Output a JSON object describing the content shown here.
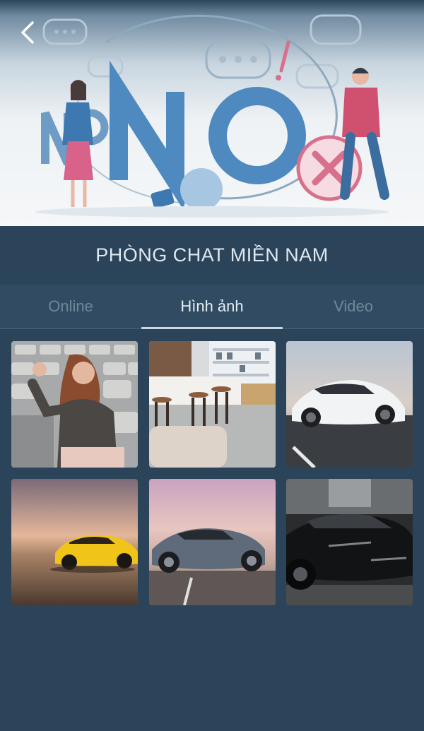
{
  "header": {
    "title": "PHÒNG CHAT MIỀN NAM",
    "back_icon": "chevron-left-icon",
    "banner_text": "NO NO"
  },
  "tabs": [
    {
      "label": "Online",
      "active": false
    },
    {
      "label": "Hình ảnh",
      "active": true
    },
    {
      "label": "Video",
      "active": false
    }
  ],
  "gallery": {
    "items": [
      {
        "subject": "woman-waving-in-stadium-seats"
      },
      {
        "subject": "cafe-interior-with-stools"
      },
      {
        "subject": "white-sports-car"
      },
      {
        "subject": "yellow-sports-car-sunset"
      },
      {
        "subject": "grey-sports-car-pink-sky"
      },
      {
        "subject": "black-sports-car"
      }
    ]
  },
  "colors": {
    "background": "#2b4459",
    "tab_bar": "#314c62",
    "active_text": "#e4edf4",
    "inactive_text": "#6f8799"
  }
}
